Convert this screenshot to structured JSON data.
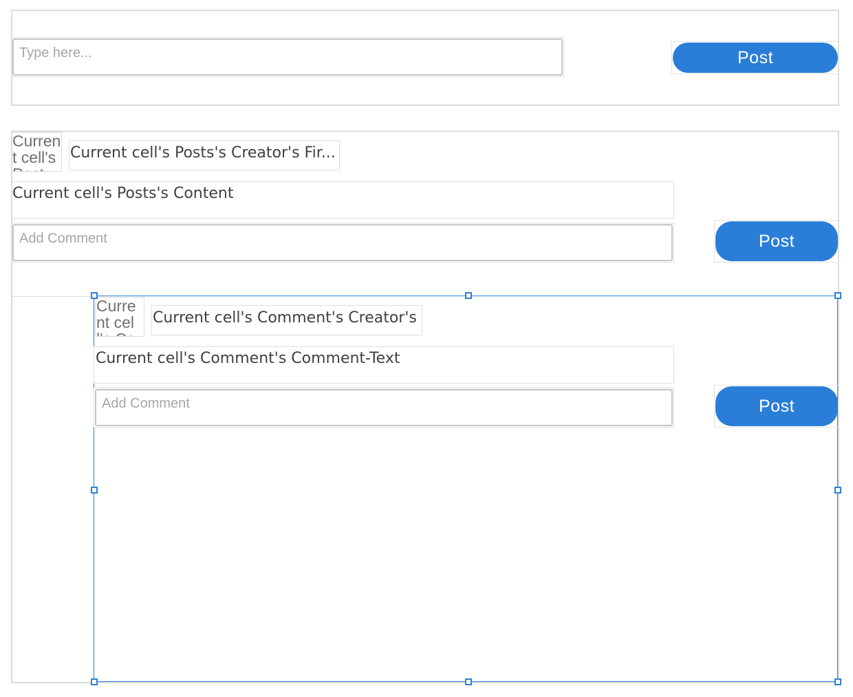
{
  "composer": {
    "input_placeholder": "Type here...",
    "post_label": "Post"
  },
  "post": {
    "avatar_text": "Current cell's Posts's Creator's Picture",
    "creator_name": "Current cell's Posts's Creator's Fir...",
    "content": "Current cell's Posts's Content",
    "comment_placeholder": "Add Comment",
    "post_label": "Post"
  },
  "comment": {
    "avatar_text": "Current cell's Comment's Creator's Picture",
    "creator_name": "Current cell's Comment's Creator's",
    "text": "Current cell's Comment's Comment-Text",
    "comment_placeholder": "Add Comment",
    "post_label": "Post"
  },
  "colors": {
    "accent": "#2b7ed8",
    "border": "#dcdcdc",
    "placeholder": "#a6a6a6"
  }
}
